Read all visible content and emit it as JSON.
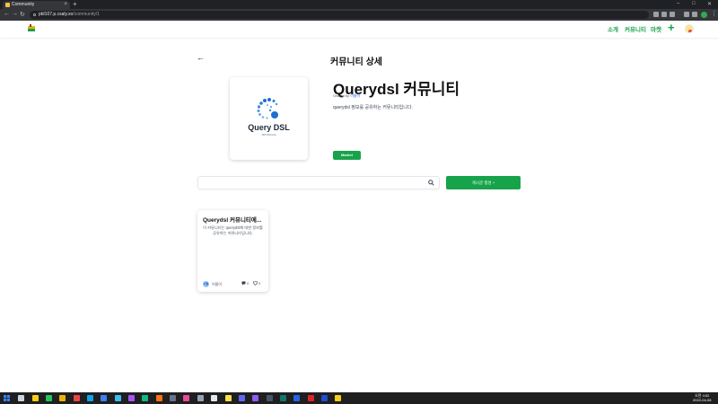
{
  "browser": {
    "tab_title": "Community",
    "url_host": "pbl107.p.csaly.xo",
    "url_path": "/community/1"
  },
  "header": {
    "nav": [
      "소개",
      "커뮤니티",
      "마켓"
    ],
    "plus_label": "+"
  },
  "page": {
    "title": "커뮤니티 상세"
  },
  "community": {
    "name": "Querydsl 커뮤니티",
    "owner_prefix": "Owned by",
    "owner_name": "이름이",
    "description": "querydsl 정보를 공유하는 커뮤니티입니다.",
    "status_button": "Market",
    "cover_title": "Query DSL",
    "cover_subtitle": "JPA Window"
  },
  "search": {
    "placeholder": ""
  },
  "create_button": "게시글 생성 +",
  "posts": [
    {
      "title": "Querydsl 커뮤니티에...",
      "body": "이 커뮤니티는 querydsl에 대한 정보를 공유하는 커뮤니티입니다.",
      "author_initials": "이름",
      "author": "이름이",
      "comments": "0",
      "likes": "0"
    }
  ],
  "taskbar": {
    "time": "오전 4:52",
    "date": "2022-04-08"
  },
  "colors": {
    "accent": "#16a34a",
    "chrome_dark": "#202124"
  }
}
